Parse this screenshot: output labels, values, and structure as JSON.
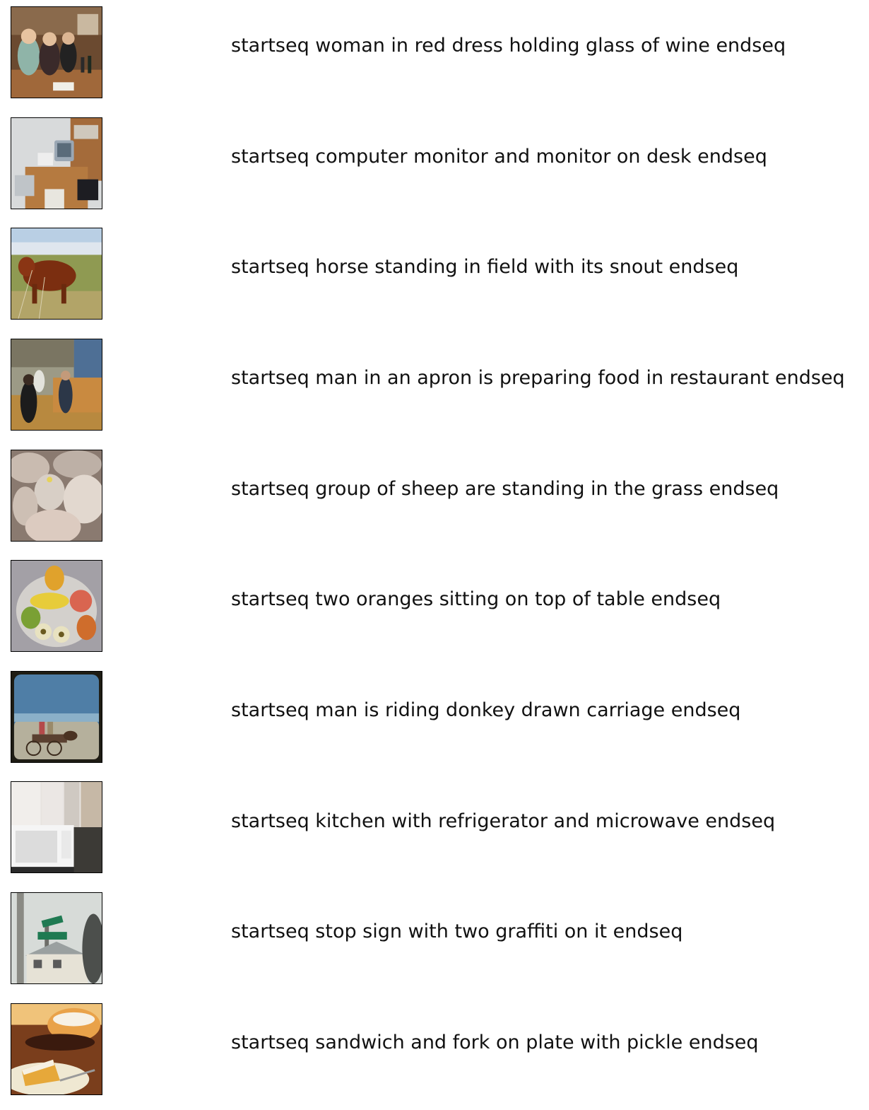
{
  "items": [
    {
      "caption": "startseq woman in red dress holding glass of wine endseq",
      "image": "people-at-table-wine-photo"
    },
    {
      "caption": "startseq computer monitor and monitor on desk endseq",
      "image": "office-desk-computer-photo"
    },
    {
      "caption": "startseq horse standing in field with its snout endseq",
      "image": "brown-cow-in-field-photo"
    },
    {
      "caption": "startseq man in an apron is preparing food in restaurant endseq",
      "image": "kitchen-with-people-photo"
    },
    {
      "caption": "startseq group of sheep are standing in the grass endseq",
      "image": "sheep-flock-photo"
    },
    {
      "caption": "startseq two oranges sitting on top of table endseq",
      "image": "fruit-bowl-photo"
    },
    {
      "caption": "startseq man is riding donkey drawn carriage endseq",
      "image": "horse-carriage-photo"
    },
    {
      "caption": "startseq kitchen with refrigerator and microwave endseq",
      "image": "kitchen-microwave-photo"
    },
    {
      "caption": "startseq stop sign with two graffiti on it endseq",
      "image": "street-signs-photo"
    },
    {
      "caption": "startseq sandwich and fork on plate with pickle endseq",
      "image": "cake-slice-plate-photo"
    }
  ]
}
